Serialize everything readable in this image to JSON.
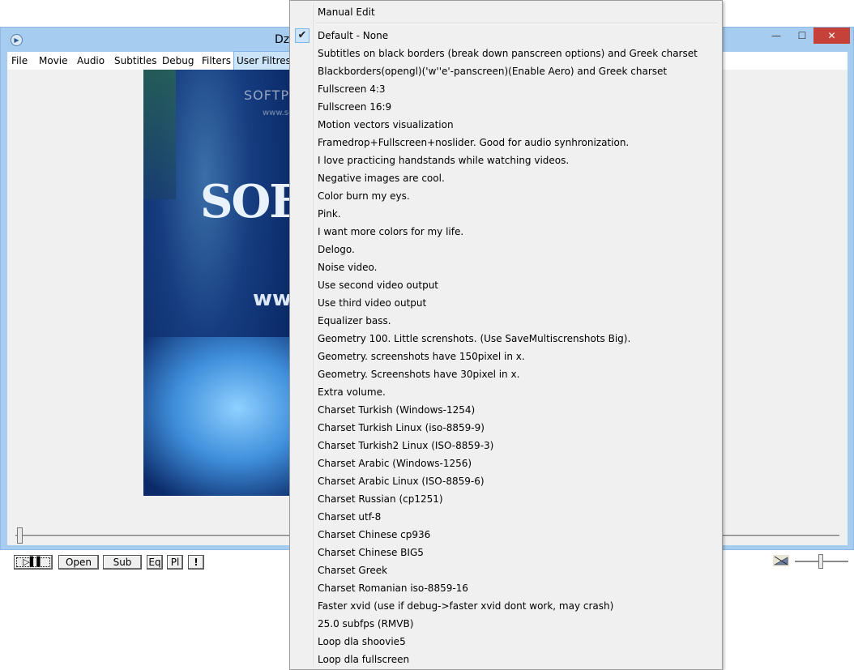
{
  "window": {
    "title": "Dz",
    "menu": [
      "File",
      "Movie",
      "Audio",
      "Subtitles",
      "Debug",
      "Filters",
      "User Filtres"
    ],
    "active_menu": "User Filtres",
    "controls": {
      "minimize": "—",
      "maximize": "☐",
      "close": "✕"
    }
  },
  "video": {
    "logo": "SOF",
    "www": "www",
    "watermark": "SOFTPEDIA",
    "watermark_sub": "www.softpedia.com"
  },
  "toolbar": {
    "play_label": "▷▌▌",
    "open_label": "Open",
    "sub_label": "Sub",
    "eq_label": "Eq",
    "pl_label": "Pl",
    "bang_label": "!"
  },
  "popup_menu": {
    "first_item": "Manual Edit",
    "checked_item": "Default - None",
    "items": [
      "Default - None",
      "Subtitles on black borders (break down panscreen options) and Greek charset",
      "Blackborders(opengl)('w''e'-panscreen)(Enable Aero) and Greek charset",
      "Fullscreen 4:3",
      "Fullscreen 16:9",
      "Motion vectors visualization",
      "Framedrop+Fullscreen+noslider. Good for audio synhronization.",
      "I love practicing handstands while watching videos.",
      "Negative images are cool.",
      "Color burn my eys.",
      "Pink.",
      "I want more colors for my life.",
      "Delogo.",
      "Noise video.",
      "Use second video output",
      "Use third video output",
      "Equalizer bass.",
      "Geometry 100. Little screnshots. (Use SaveMultiscrenshots Big).",
      "Geometry. screenshots have 150pixel in x.",
      "Geometry. Screenshots have 30pixel in x.",
      "Extra volume.",
      "Charset Turkish (Windows-1254)",
      "Charset Turkish Linux (iso-8859-9)",
      "Charset Turkish2 Linux (ISO-8859-3)",
      "Charset Arabic (Windows-1256)",
      "Charset Arabic Linux (ISO-8859-6)",
      "Charset Russian (cp1251)",
      "Charset utf-8",
      "Charset Chinese cp936",
      "Charset Chinese BIG5",
      "Charset Greek",
      "Charset Romanian iso-8859-16",
      "Faster xvid (use if debug->faster xvid dont work, may crash)",
      " 25.0 subfps (RMVB)",
      "Loop dla shoovie5",
      "Loop dla fullscreen"
    ],
    "check_icon": "check-icon"
  }
}
